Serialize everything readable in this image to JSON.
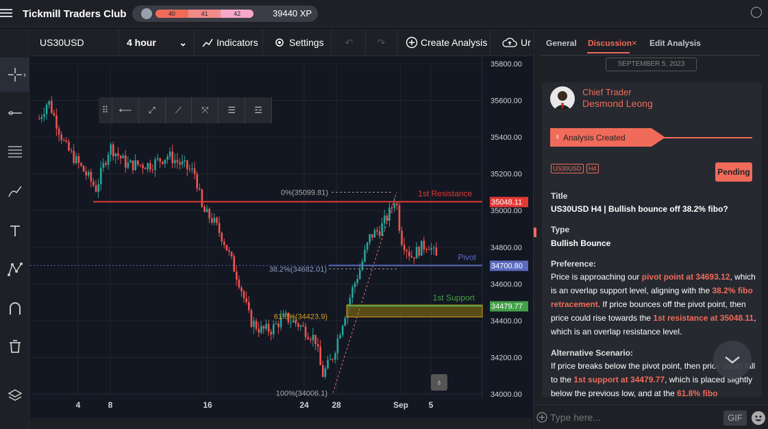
{
  "app": {
    "brand": "Tickmill Traders Club",
    "xp_levels": [
      "40",
      "41",
      "42"
    ],
    "xp": "39440 XP"
  },
  "toolbar": {
    "symbol": "US30USD",
    "timeframe": "4 hour",
    "indicators": "Indicators",
    "settings": "Settings",
    "create": "Create Analysis",
    "upload": "Ur"
  },
  "drawing_toolbar": {
    "icons": [
      "grip-icon",
      "horizontal-line-icon",
      "ray-icon",
      "trend-line-icon",
      "extended-line-icon",
      "fib-retracement-icon",
      "fib-extension-icon"
    ]
  },
  "chart_data": {
    "type": "candlestick",
    "symbol": "US30USD",
    "timeframe": "4 hour",
    "ylim": [
      34000,
      35800
    ],
    "y_ticks": [
      "35800.00",
      "35600.00",
      "35400.00",
      "35200.00",
      "35000.00",
      "34800.00",
      "34600.00",
      "34400.00",
      "34200.00",
      "34000.00"
    ],
    "x_ticks": [
      "4",
      "8",
      "16",
      "24",
      "28",
      "Sep",
      "5"
    ],
    "levels": [
      {
        "label": "1st Resistance",
        "value": 35048.11,
        "price_label": "35048.11",
        "color": "#e53935"
      },
      {
        "label": "Pivot",
        "value": 34700.8,
        "price_label": "34700.80",
        "color": "#5c6bc0"
      },
      {
        "label": "1st Support",
        "value": 34479.77,
        "price_label": "34479.77",
        "color": "#43a047"
      }
    ],
    "fib_labels": [
      "0%(35099.81)",
      "38.2%(34682.01)",
      "61.8%(34423.9)",
      "100%(34006.1)"
    ],
    "support_zone": [
      34420,
      34485
    ]
  },
  "panel": {
    "tabs": [
      "General",
      "Discussion",
      "Edit Analysis"
    ],
    "date": "SEPTEMBER 5, 2023",
    "author_role": "Chief Trader",
    "author_name": "Desmond Leong",
    "banner": "Analysis Created",
    "tags": [
      "US30USD",
      "H4"
    ],
    "status": "Pending",
    "title_label": "Title",
    "title": "US30USD H4 | Bullish bounce off 38.2% fibo?",
    "type_label": "Type",
    "type": "Bullish Bounce",
    "pref_label": "Preference:",
    "pref": {
      "t1": "Price is approaching our ",
      "h1": "pivot point at 34693.12",
      "t2": ", which is an overlap support level, aligning with the ",
      "h2": "38.2% fibo retracement",
      "t3": ". If price bounces off the pivot point, then price could rise towards the ",
      "h3": "1st resistance at 35048.11",
      "t4": ", which is an overlap resistance level."
    },
    "alt_label": "Alternative Scenario:",
    "alt": {
      "t1": "If price breaks below the pivot point, then price could fall to the ",
      "h1": "1st support at 34479.77",
      "t2": ", which is placed slightly below the previous low, and at the ",
      "h2": "61.8% fibo"
    },
    "input_placeholder": "Type here...",
    "gif": "GIF"
  },
  "colors": {
    "accent": "#f06b5a",
    "up": "#26a69a",
    "down": "#ef5350"
  }
}
